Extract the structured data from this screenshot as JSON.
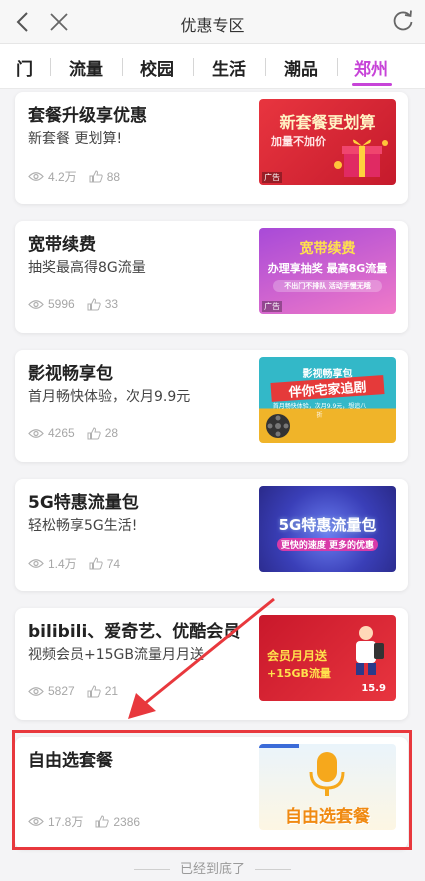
{
  "header": {
    "title": "优惠专区"
  },
  "tabs": [
    {
      "label": "门"
    },
    {
      "label": "流量"
    },
    {
      "label": "校园"
    },
    {
      "label": "生活"
    },
    {
      "label": "潮品"
    },
    {
      "label": "郑州"
    }
  ],
  "cards": [
    {
      "title": "套餐升级享优惠",
      "subtitle": "新套餐 更划算!",
      "views": "4.2万",
      "likes": "88",
      "banner": {
        "text1": "新套餐更划算",
        "text2": "加量不加价",
        "tag": "广告",
        "color1": "#e8353f",
        "color2": "#c51a2c"
      }
    },
    {
      "title": "宽带续费",
      "subtitle": "抽奖最高得8G流量",
      "views": "5996",
      "likes": "33",
      "banner": {
        "text1": "宽带续费",
        "text2": "办理享抽奖 最高8G流量",
        "text3": "不出门不排队 活动手慢无哦",
        "tag": "广告",
        "color1": "#a84ad8",
        "color2": "#f07ac8"
      }
    },
    {
      "title": "影视畅享包",
      "subtitle": "首月畅快体验，次月9.9元",
      "views": "4265",
      "likes": "28",
      "banner": {
        "text1": "影视畅享包",
        "text2": "伴你宅家追剧",
        "text3": "首月畅快体验，次月9.9元，想追八折",
        "color1": "#2fb7c9",
        "color2": "#f0b429"
      }
    },
    {
      "title": "5G特惠流量包",
      "subtitle": "轻松畅享5G生活!",
      "views": "1.4万",
      "likes": "74",
      "banner": {
        "text1": "5G特惠流量包",
        "text2": "更快的速度 更多的优惠",
        "color1": "#3a3fb8",
        "color2": "#6b49d6"
      }
    },
    {
      "title": "bilibili、爱奇艺、优酷会员",
      "subtitle": "视频会员+15GB流量月月送",
      "views": "5827",
      "likes": "21",
      "banner": {
        "text1": "会员月月送",
        "text2": "+15GB流量",
        "text3": "15.9",
        "color1": "#c9182b",
        "color2": "#e8353f"
      }
    },
    {
      "title": "自由选套餐",
      "subtitle": "",
      "views": "17.8万",
      "likes": "2386",
      "banner": {
        "text1": "自由选套餐",
        "color1": "#eaf4fb",
        "color2": "#fdf6e3"
      }
    }
  ],
  "footer": {
    "text": "已经到底了"
  },
  "colors": {
    "accent": "#c744d8",
    "highlight": "#e8383d"
  }
}
